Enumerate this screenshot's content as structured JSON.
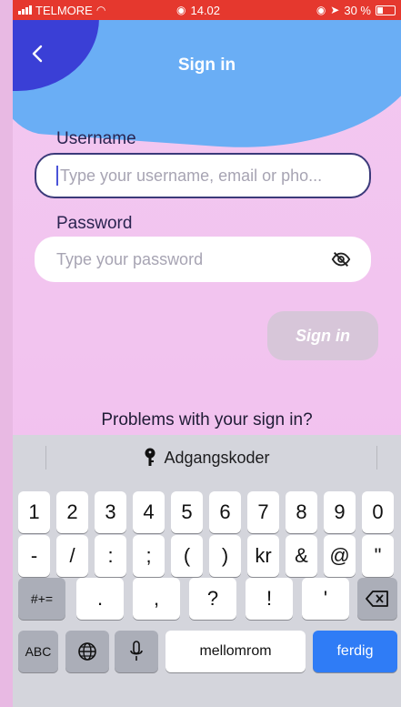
{
  "status_bar": {
    "carrier": "TELMORE",
    "time": "14.02",
    "battery": "30 %"
  },
  "header": {
    "back_icon": "chevron-left-icon",
    "title": "Sign in"
  },
  "form": {
    "username_label": "Username",
    "username_placeholder": "Type your username, email or pho...",
    "password_label": "Password",
    "password_placeholder": "Type your password",
    "visibility_icon": "eye-slash-icon",
    "submit_label": "Sign in"
  },
  "help_text": "Problems with your sign in?",
  "keyboard": {
    "suggestion": "Adgangskoder",
    "row1": [
      "1",
      "2",
      "3",
      "4",
      "5",
      "6",
      "7",
      "8",
      "9",
      "0"
    ],
    "row2": [
      "-",
      "/",
      ":",
      ";",
      "(",
      ")",
      "kr",
      "&",
      "@",
      "\""
    ],
    "row3_left": "#+=",
    "row3": [
      ".",
      ",",
      "?",
      "!",
      "'"
    ],
    "abc": "ABC",
    "space": "mellomrom",
    "return": "ferdig"
  },
  "colors": {
    "status_bar": "#e5382e",
    "background": "#f3c8f0",
    "blob_blue": "#6aaef5",
    "blob_dark": "#3a3fd6",
    "accent_blue": "#2f7cf6"
  }
}
